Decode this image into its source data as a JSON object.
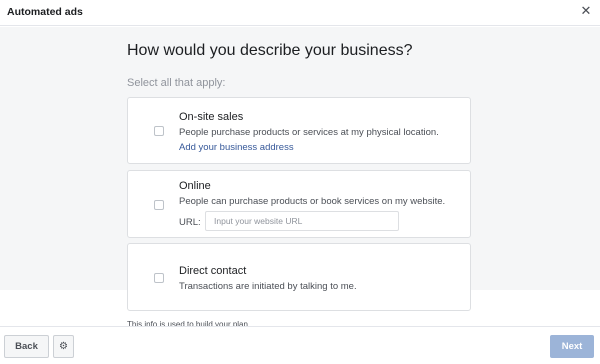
{
  "header": {
    "title": "Automated ads",
    "close_icon": "close-icon",
    "close_glyph": "✕"
  },
  "main": {
    "question": "How would you describe your business?",
    "hint": "Select all that apply:",
    "options": [
      {
        "title": "On-site sales",
        "description": "People purchase products or services at my physical location.",
        "link": "Add your business address",
        "checked": false
      },
      {
        "title": "Online",
        "description": "People can purchase products or book services on my website.",
        "url_label": "URL:",
        "url_placeholder": "Input your website URL",
        "url_value": "",
        "checked": false
      },
      {
        "title": "Direct contact",
        "description": "Transactions are initiated by talking to me.",
        "checked": false
      }
    ],
    "info_note": "This info is used to build your plan."
  },
  "footer": {
    "back_label": "Back",
    "settings_icon": "gear-icon",
    "settings_glyph": "⚙",
    "next_label": "Next",
    "next_enabled": false
  },
  "colors": {
    "accent": "#365899",
    "next_disabled_bg": "#9cb4d8",
    "page_bg": "#f5f6f7",
    "border": "#dddfe2"
  }
}
